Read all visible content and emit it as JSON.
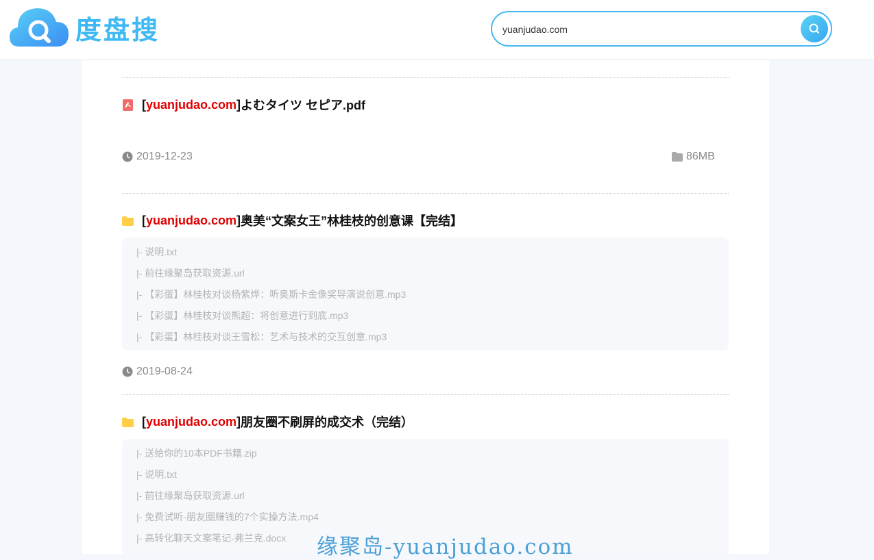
{
  "logo": {
    "text": "度盘搜"
  },
  "search": {
    "value": "yuanjudao.com"
  },
  "results": [
    {
      "icon": "pdf-icon",
      "highlight": "yuanjudao.com",
      "title": "よむタイツ セピア.pdf",
      "date": "2019-12-23",
      "size": "86MB"
    },
    {
      "icon": "folder-icon",
      "highlight": "yuanjudao.com",
      "title": "奥美“文案女王”林桂枝的创意课【完结】",
      "files": [
        "|- 说明.txt",
        "|- 前往缘聚岛获取资源.url",
        "|- 【彩蛋】林桂枝对谈杨紫烨：听奥斯卡金像奖导演说创意.mp3",
        "|- 【彩蛋】林桂枝对谈熊超：将创意进行到底.mp3",
        "|- 【彩蛋】林桂枝对谈王雪松：艺术与技术的交互创意.mp3"
      ],
      "date": "2019-08-24"
    },
    {
      "icon": "folder-icon",
      "highlight": "yuanjudao.com",
      "title": "朋友圈不刷屏的成交术（完结）",
      "files": [
        "|- 送给你的10本PDF书籍.zip",
        "|- 说明.txt",
        "|- 前往缘聚岛获取资源.url",
        "|- 免费试听-朋友圈赚钱的7个实操方法.mp4",
        "|- 高转化聊天文案笔记-弗兰克.docx"
      ]
    }
  ],
  "watermark": "缘聚岛-yuanjudao.com",
  "colors": {
    "accent": "#45b6f2",
    "highlight": "#e00000",
    "folder": "#ffcf4a",
    "pdf": "#f26b6b"
  }
}
